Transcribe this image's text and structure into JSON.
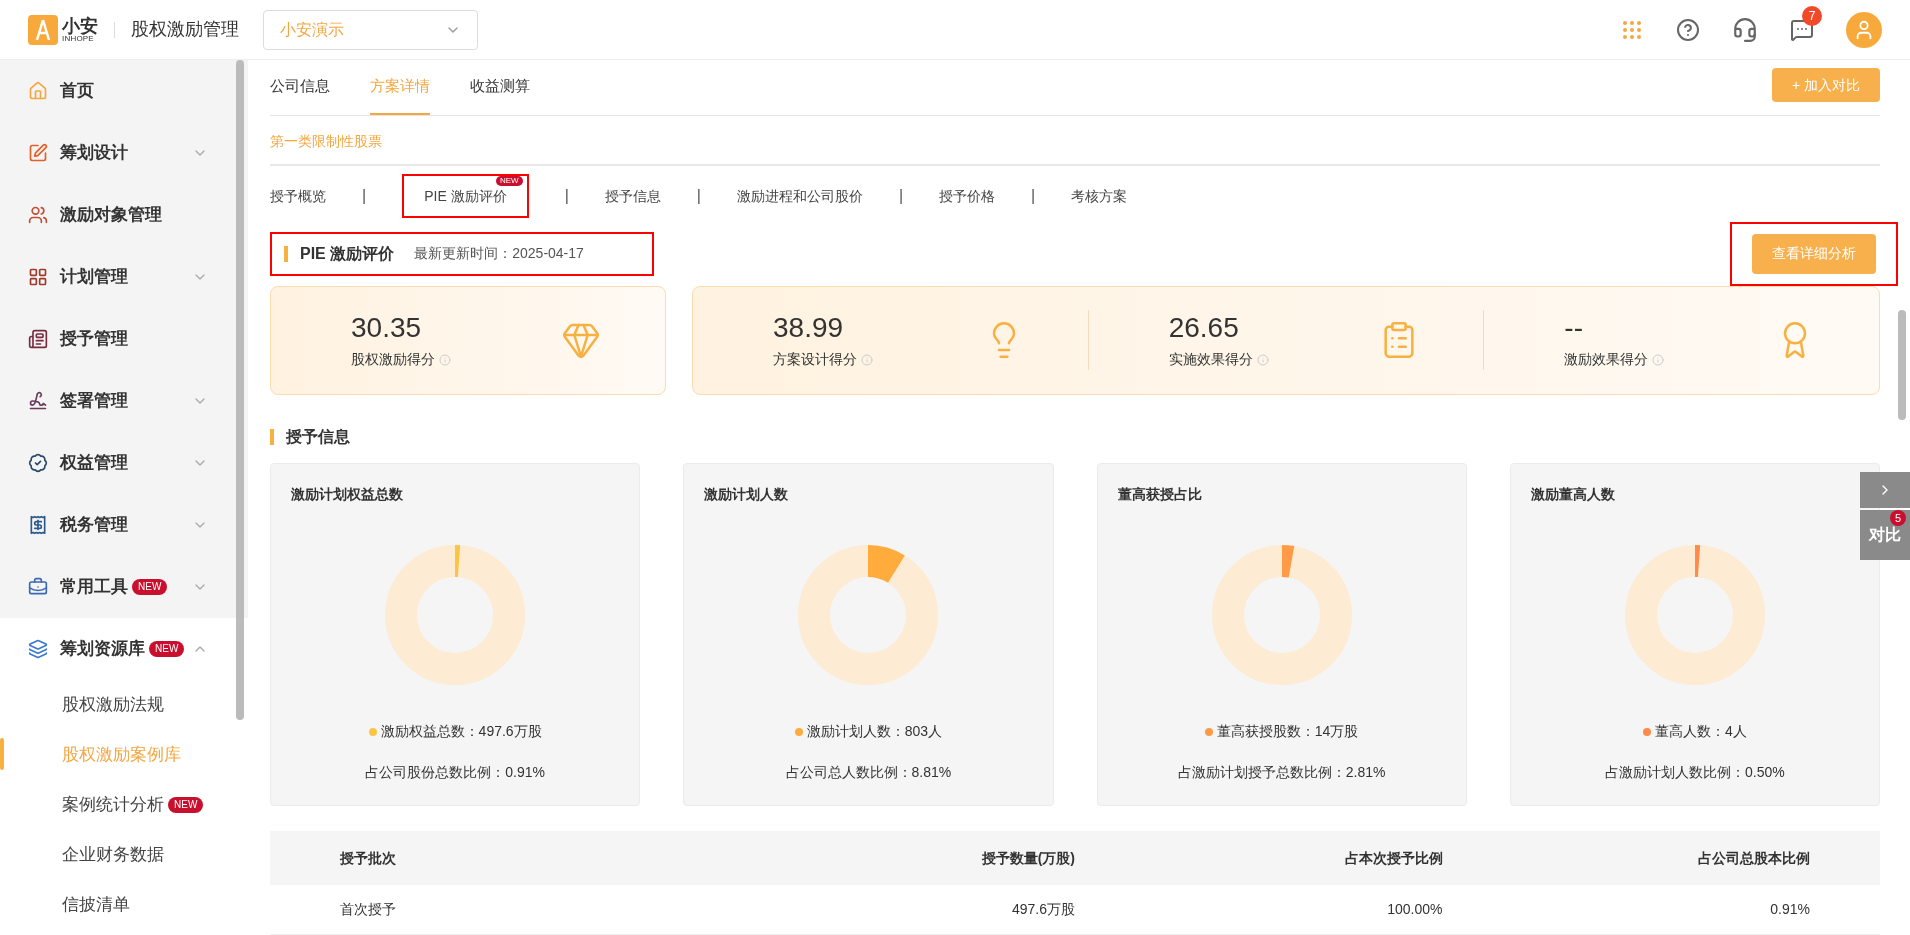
{
  "header": {
    "logo_text": "小安",
    "logo_sub": "INHOPE",
    "title": "股权激励管理",
    "company_select": "小安演示",
    "notifications": "7"
  },
  "sidebar": {
    "items": [
      {
        "label": "首页"
      },
      {
        "label": "筹划设计",
        "expanded": false
      },
      {
        "label": "激励对象管理"
      },
      {
        "label": "计划管理",
        "expanded": false
      },
      {
        "label": "授予管理"
      },
      {
        "label": "签署管理",
        "expanded": false
      },
      {
        "label": "权益管理",
        "expanded": false
      },
      {
        "label": "税务管理",
        "expanded": false
      },
      {
        "label": "常用工具",
        "badge": "NEW",
        "expanded": false
      },
      {
        "label": "筹划资源库",
        "badge": "NEW",
        "expanded": true,
        "children": [
          {
            "label": "股权激励法规",
            "selected": false
          },
          {
            "label": "股权激励案例库",
            "selected": true
          },
          {
            "label": "案例统计分析",
            "badge": "NEW",
            "selected": false
          },
          {
            "label": "企业财务数据",
            "selected": false
          },
          {
            "label": "信披清单",
            "selected": false
          }
        ]
      }
    ]
  },
  "top_tabs": [
    {
      "label": "公司信息",
      "selected": false
    },
    {
      "label": "方案详情",
      "selected": true
    },
    {
      "label": "收益测算",
      "selected": false
    }
  ],
  "add_compare_button": "+ 加入对比",
  "stock_type_tab": {
    "label": "第一类限制性股票",
    "selected": true
  },
  "section_tabs": [
    {
      "label": "授予概览",
      "selected": false,
      "highlighted": false
    },
    {
      "label": "PIE 激励评价",
      "badge": "NEW",
      "selected": false,
      "highlighted": true
    },
    {
      "label": "授予信息",
      "selected": false,
      "highlighted": false
    },
    {
      "label": "激励进程和公司股价",
      "selected": false,
      "highlighted": false
    },
    {
      "label": "授予价格",
      "selected": false,
      "highlighted": false
    },
    {
      "label": "考核方案",
      "selected": false,
      "highlighted": false
    }
  ],
  "section_separator": "|",
  "pie": {
    "title": "PIE 激励评价",
    "updated": "最新更新时间：2025-04-17",
    "highlighted": true,
    "detail_button": {
      "label": "查看详细分析",
      "highlighted": true
    },
    "main_score": {
      "value": "30.35",
      "label": "股权激励得分"
    },
    "scores": [
      {
        "value": "38.99",
        "label": "方案设计得分"
      },
      {
        "value": "26.65",
        "label": "实施效果得分"
      },
      {
        "value": "--",
        "label": "激励效果得分"
      }
    ]
  },
  "grant_info": {
    "title": "授予信息",
    "cards": [
      {
        "title": "激励计划权益总数",
        "level": 0.0091,
        "color": "#fbc443",
        "legend": "激励权益总数：497.6万股",
        "ratio": "占公司股份总数比例：0.91%"
      },
      {
        "title": "激励计划人数",
        "level": 0.0881,
        "color": "#ffac3d",
        "legend": "激励计划人数：803人",
        "ratio": "占公司总人数比例：8.81%"
      },
      {
        "title": "董高获授占比",
        "level": 0.0281,
        "color": "#ff9b47",
        "legend": "董高获授股数：14万股",
        "ratio": "占激励计划授予总数比例：2.81%"
      },
      {
        "title": "激励董高人数",
        "level": 0.005,
        "color": "#ff8a4a",
        "legend": "董高人数：4人",
        "ratio": "占激励计划人数比例：0.50%"
      }
    ]
  },
  "table": {
    "columns": [
      "授予批次",
      "授予数量(万股)",
      "占本次授予比例",
      "占公司总股本比例"
    ],
    "rows": [
      [
        "首次授予",
        "497.6万股",
        "100.00%",
        "0.91%"
      ]
    ]
  },
  "float": {
    "compare": "对比",
    "count": "5"
  }
}
